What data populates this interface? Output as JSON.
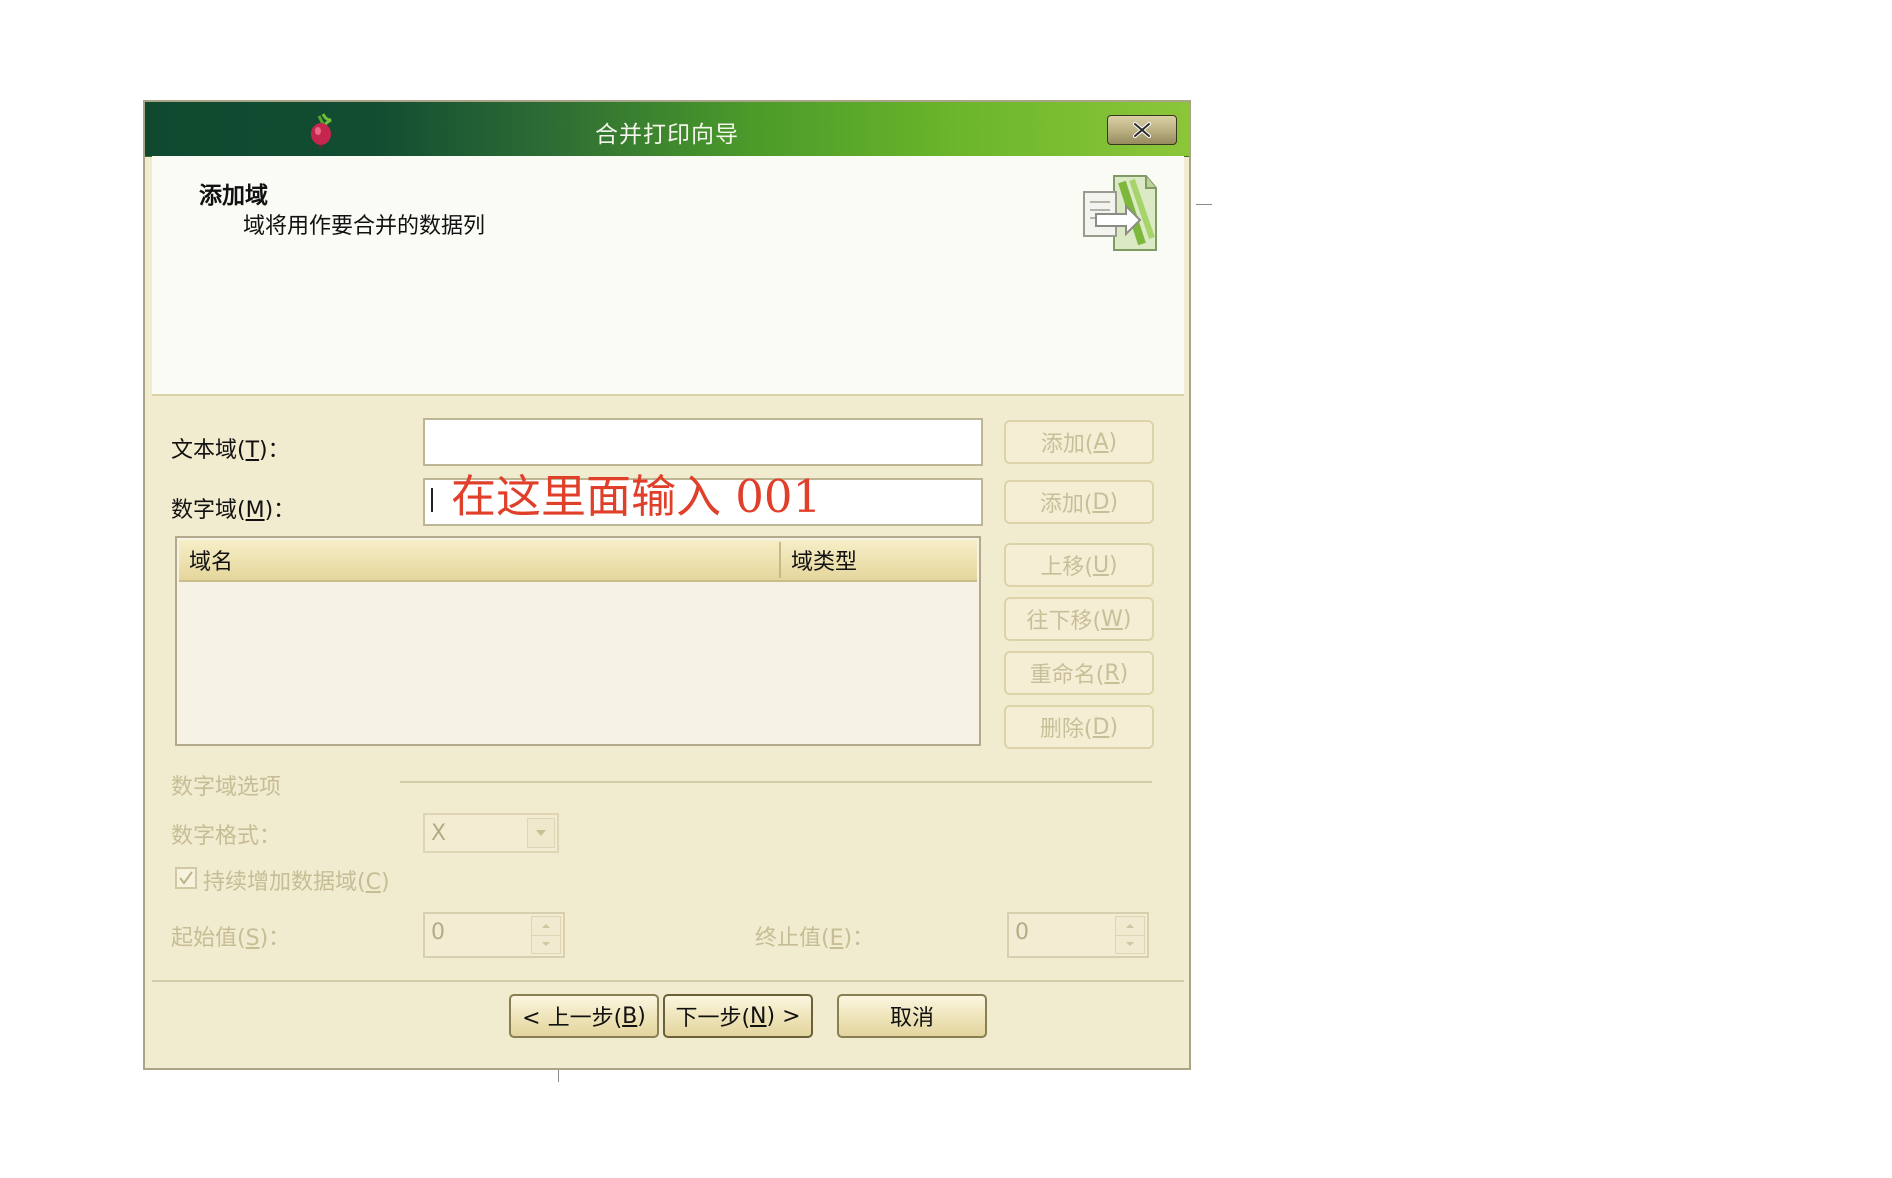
{
  "dialog": {
    "title": "合并打印向导",
    "close_label": "✕",
    "header": {
      "title": "添加域",
      "subtitle": "域将用作要合并的数据列"
    }
  },
  "fields": {
    "text_field": {
      "label_pre": "文本域(",
      "label_key": "T",
      "label_post": ")：",
      "value": "",
      "add_pre": "添加(",
      "add_key": "A",
      "add_post": ")"
    },
    "number_field": {
      "label_pre": "数字域(",
      "label_key": "M",
      "label_post": ")：",
      "annotation": "在这里面输入 001",
      "add_pre": "添加(",
      "add_key": "D",
      "add_post": ")"
    }
  },
  "field_list": {
    "columns": [
      "域名",
      "域类型"
    ],
    "rows": []
  },
  "side_buttons": {
    "move_up": {
      "pre": "上移(",
      "key": "U",
      "post": ")"
    },
    "move_down": {
      "pre": "往下移(",
      "key": "W",
      "post": ")"
    },
    "rename": {
      "pre": "重命名(",
      "key": "R",
      "post": ")"
    },
    "delete": {
      "pre": "删除(",
      "key": "D",
      "post": ")"
    }
  },
  "number_options": {
    "group_title": "数字域选项",
    "format_label": "数字格式：",
    "format_value": "X",
    "auto_increment": {
      "pre": "持续增加数据域(",
      "key": "C",
      "post": ")",
      "checked": true
    },
    "start": {
      "pre": "起始值(",
      "key": "S",
      "post": ")：",
      "value": "0"
    },
    "end": {
      "pre": "终止值(",
      "key": "E",
      "post": ")：",
      "value": "0"
    }
  },
  "footer": {
    "back": {
      "pre": "< 上一步(",
      "key": "B",
      "post": ")"
    },
    "next": {
      "pre": "下一步(",
      "key": "N",
      "post": ") >"
    },
    "cancel": "取消"
  },
  "colors": {
    "titlebar_dark": "#0f4a30",
    "titlebar_light": "#8cc63a",
    "annotation": "#e0402a",
    "dialog_bg": "#f1ebcf"
  }
}
